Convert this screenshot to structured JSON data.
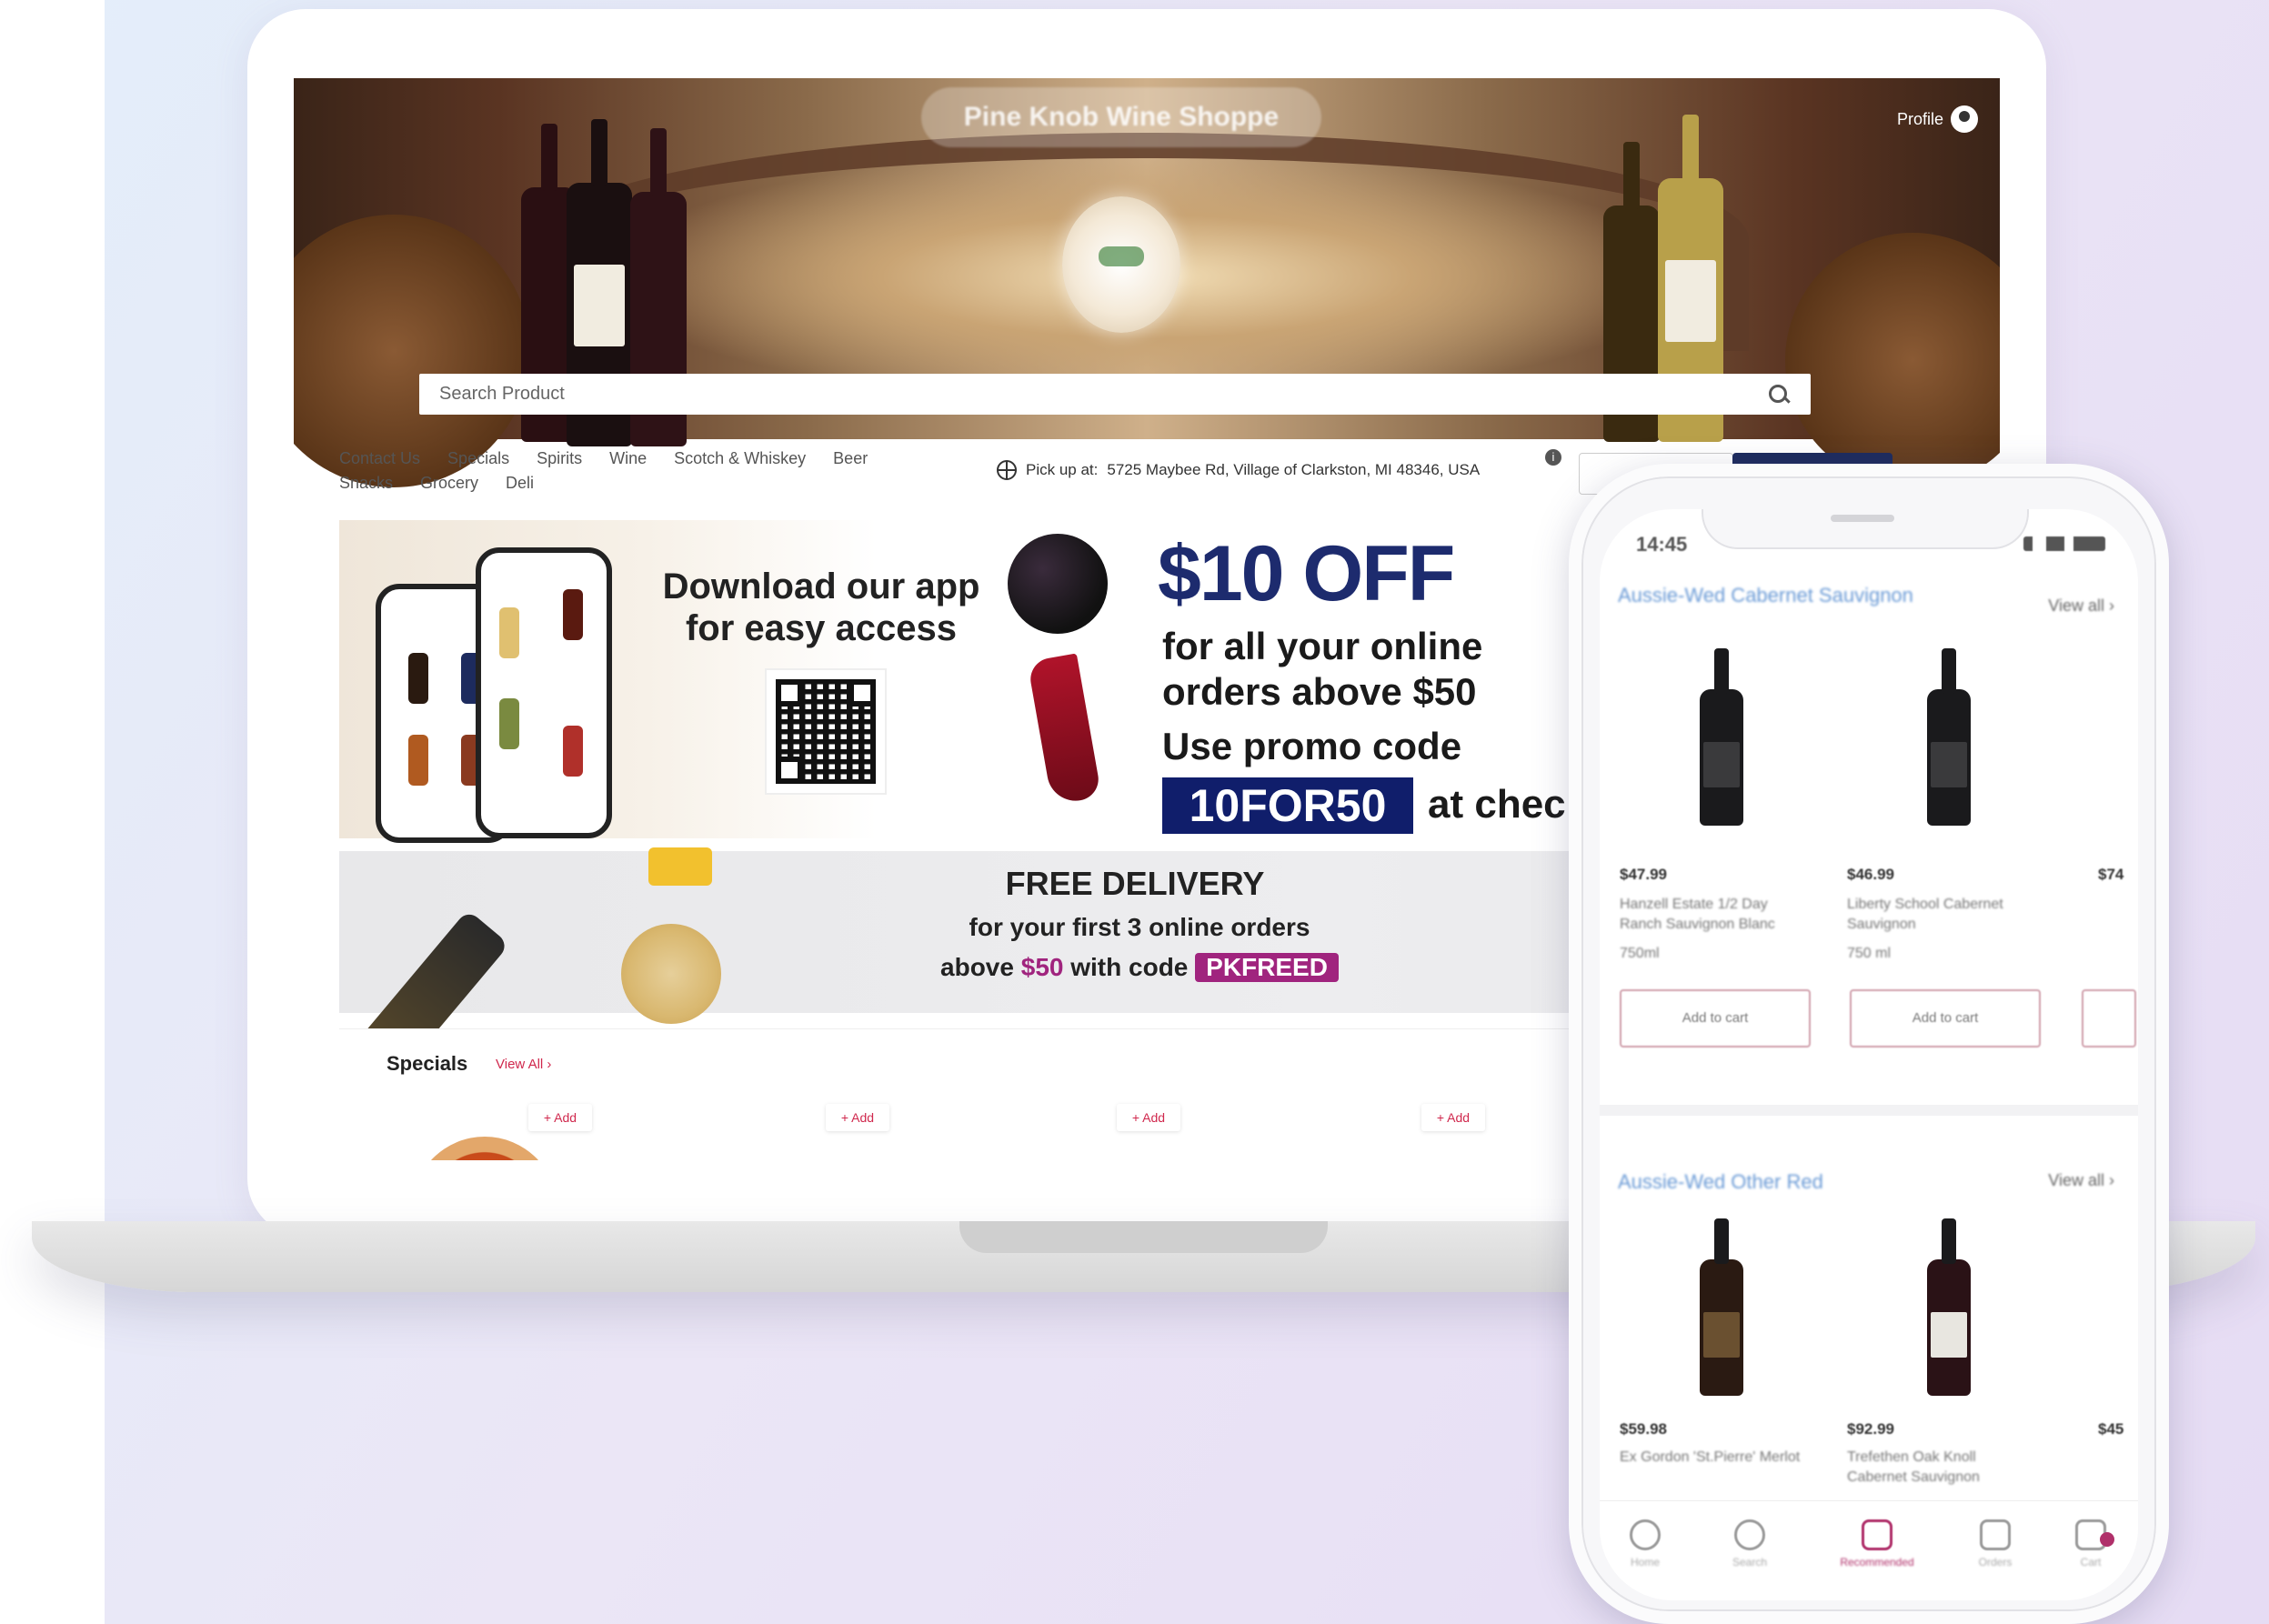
{
  "website": {
    "store_name": "Pine Knob Wine Shoppe",
    "profile_label": "Profile",
    "search": {
      "placeholder": "Search Product"
    },
    "nav_items": [
      "Contact Us",
      "Specials",
      "Spirits",
      "Wine",
      "Scotch & Whiskey",
      "Beer",
      "Snacks",
      "Grocery",
      "Deli"
    ],
    "pickup_label": "Pick up at:",
    "pickup_address": "5725 Maybee Rd, Village of Clarkston, MI 48346, USA",
    "promo_app": {
      "line1": "Download our app",
      "line2": "for easy access"
    },
    "promo_discount": {
      "headline": "$10 OFF",
      "line1": "for all your online",
      "line2": "orders above $50",
      "line3": "Use promo code",
      "code": "10FOR50",
      "suffix": "at chec"
    },
    "promo_delivery": {
      "title": "FREE DELIVERY",
      "line1": "for your first 3 online orders",
      "line2_pre": "above",
      "line2_amount": "$50",
      "line2_mid": "with code",
      "code": "PKFREED"
    },
    "specials": {
      "title": "Specials",
      "view_all": "View All ›",
      "add_label": "+ Add"
    }
  },
  "mobile": {
    "status_time": "14:45",
    "section1": {
      "title": "Aussie-Wed Cabernet Sauvignon",
      "view_all": "View all ›"
    },
    "section1_products": [
      {
        "price": "$47.99",
        "name": "Hanzell Estate 1/2 Day Ranch Sauvignon Blanc",
        "size": "750ml",
        "cta": "Add to cart"
      },
      {
        "price": "$46.99",
        "name": "Liberty School Cabernet Sauvignon",
        "size": "750 ml",
        "cta": "Add to cart"
      },
      {
        "price": "$74"
      }
    ],
    "section2": {
      "title": "Aussie-Wed Other Red",
      "view_all": "View all ›"
    },
    "section2_products": [
      {
        "price": "$59.98",
        "name": "Ex Gordon 'St.Pierre' Merlot"
      },
      {
        "price": "$92.99",
        "name": "Trefethen Oak Knoll Cabernet Sauvignon"
      },
      {
        "price": "$45"
      }
    ],
    "tabs": [
      {
        "label": "Home",
        "active": false
      },
      {
        "label": "Search",
        "active": false
      },
      {
        "label": "Recommended",
        "active": true
      },
      {
        "label": "Orders",
        "active": false
      },
      {
        "label": "Cart",
        "active": false
      }
    ]
  },
  "colors": {
    "navy": "#1d2b6e",
    "magenta": "#a0247e",
    "red_link": "#d0284d",
    "blue_title": "#6b9bd6"
  },
  "icons": [
    "search-icon",
    "profile-icon",
    "globe-icon",
    "info-icon",
    "home-icon",
    "search-tab-icon",
    "recommended-icon",
    "orders-icon",
    "cart-icon"
  ]
}
